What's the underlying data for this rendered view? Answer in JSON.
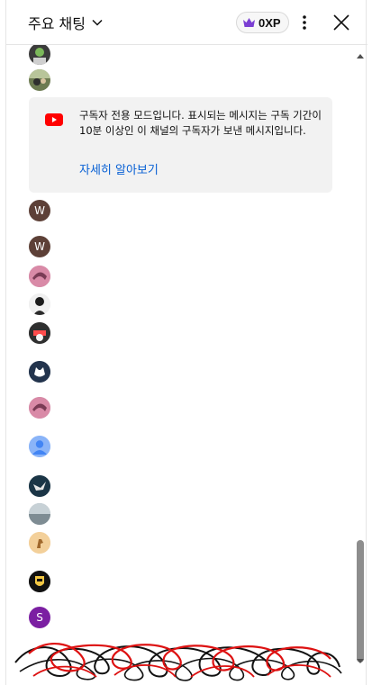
{
  "header": {
    "title": "주요 채팅",
    "xp_label": "0XP",
    "icons": {
      "dropdown": "chevron-down-icon",
      "xp": "crown-icon",
      "menu": "more-vert-icon",
      "close": "close-icon"
    },
    "xp_color": "#7b3fd3"
  },
  "notice": {
    "icon": "youtube-icon",
    "message": "구독자 전용 모드입니다. 표시되는 메시지는 구독 기간이 10분 이상인 이 채널의 구독자가 보낸 메시지입니다.",
    "link": "자세히 알아보기",
    "link_color": "#065fd4"
  },
  "avatars": {
    "w1": "W",
    "w2": "W",
    "s": "S",
    "w_color": "#5d4037",
    "s_color": "#7b1fa2",
    "default_color": "#4285f4"
  }
}
